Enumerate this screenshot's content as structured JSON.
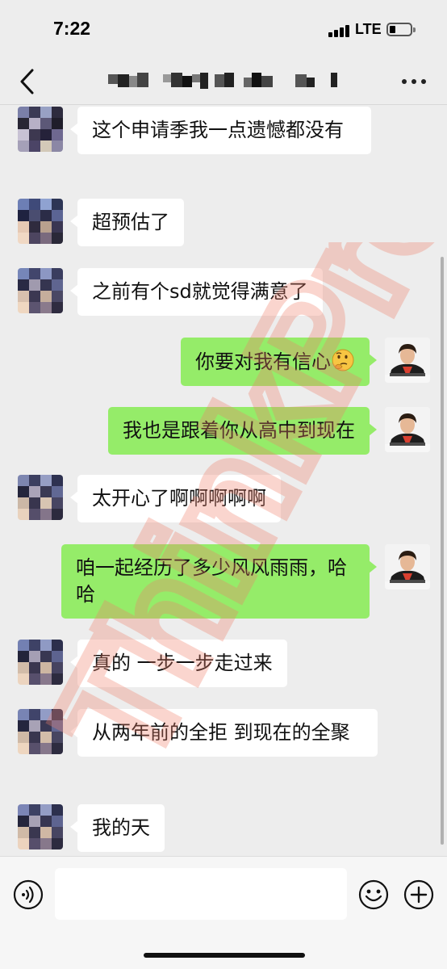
{
  "status_bar": {
    "time": "7:22",
    "network": "LTE",
    "battery_level": 0.2
  },
  "nav": {
    "back_icon": "chevron-left-icon",
    "title_obscured": true,
    "more_icon": "more-dots-icon"
  },
  "messages": [
    {
      "side": "in",
      "text": "这个申请季我一点遗憾都没有"
    },
    {
      "side": "in",
      "text": "超预估了"
    },
    {
      "side": "in",
      "text": "之前有个sd就觉得满意了"
    },
    {
      "side": "out",
      "text": "你要对我有信心",
      "emoji": "thinking-face-icon"
    },
    {
      "side": "out",
      "text": "我也是跟着你从高中到现在"
    },
    {
      "side": "in",
      "text": "太开心了啊啊啊啊啊"
    },
    {
      "side": "out",
      "text": "咱一起经历了多少风风雨雨，哈哈"
    },
    {
      "side": "in",
      "text": "真的 一步一步走过来"
    },
    {
      "side": "in",
      "text": "从两年前的全拒 到现在的全聚"
    },
    {
      "side": "in",
      "text": "我的天"
    }
  ],
  "input_bar": {
    "voice_icon": "voice-icon",
    "input_value": "",
    "emoji_icon": "smiley-icon",
    "plus_icon": "plus-icon"
  },
  "watermark": {
    "text": "ThinkPro",
    "color": "#f2a090"
  },
  "colors": {
    "background": "#ededed",
    "incoming": "#ffffff",
    "outgoing": "#95ec69"
  }
}
